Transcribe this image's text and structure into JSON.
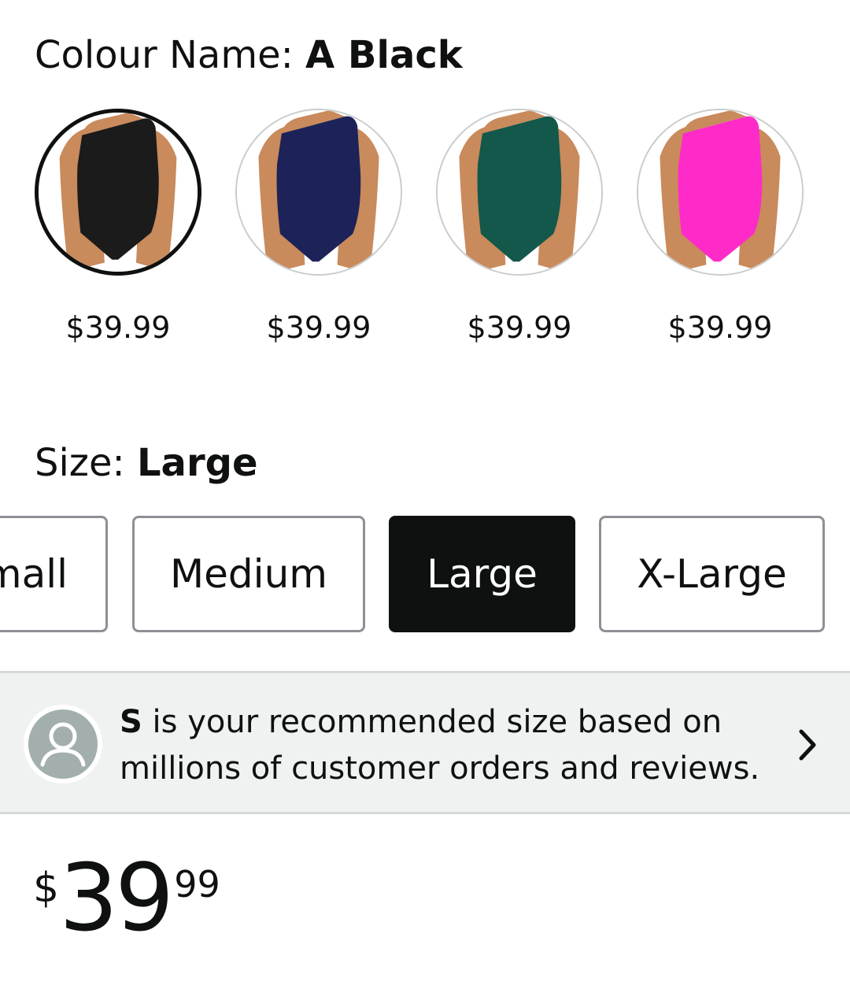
{
  "colour": {
    "label": "Colour Name: ",
    "value": "A Black",
    "swatches": [
      {
        "color": "#1b1b1b",
        "price": "$39.99",
        "selected": true
      },
      {
        "color": "#1d2358",
        "price": "$39.99",
        "selected": false
      },
      {
        "color": "#14574b",
        "price": "$39.99",
        "selected": false
      },
      {
        "color": "#ff2bc8",
        "price": "$39.99",
        "selected": false
      }
    ]
  },
  "size": {
    "label": "Size: ",
    "value": "Large",
    "options": [
      "mall",
      "Medium",
      "Large",
      "X-Large"
    ]
  },
  "recommendation": {
    "bold": "S",
    "text": " is your recommended size based on millions of customer orders and reviews."
  },
  "price": {
    "symbol": "$",
    "whole": "39",
    "fraction": "99"
  },
  "colors": {
    "text": "#0f1111",
    "skin": "#c98a5c",
    "selected_bg": "#0f1111",
    "banner_bg": "#f0f2f2"
  }
}
